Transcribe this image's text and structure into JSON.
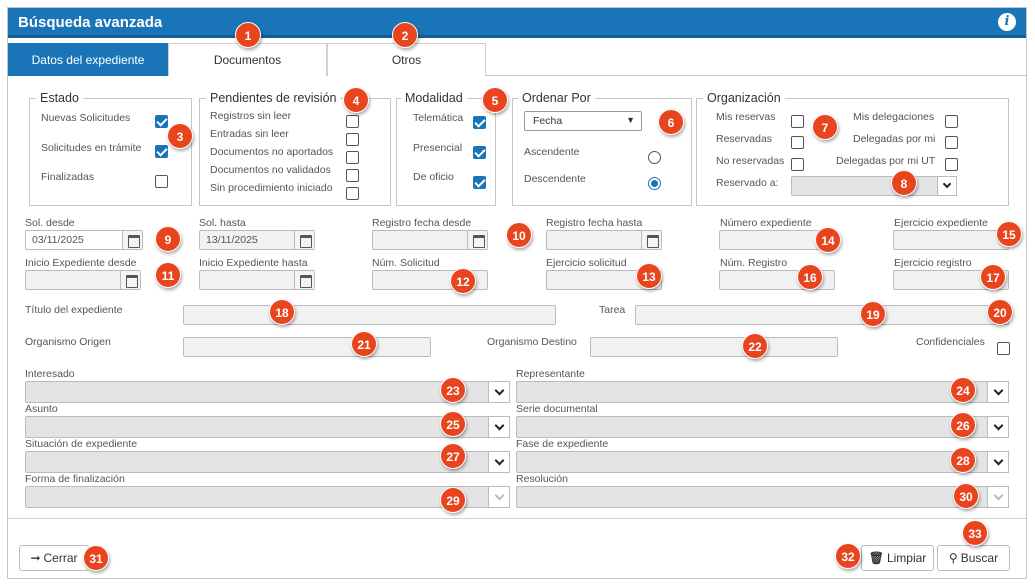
{
  "window": {
    "title": "Búsqueda avanzada",
    "info_icon": "info-icon"
  },
  "tabs": [
    {
      "label": "Datos del expediente",
      "active": true
    },
    {
      "label": "Documentos",
      "active": false
    },
    {
      "label": "Otros",
      "active": false
    }
  ],
  "estado": {
    "legend": "Estado",
    "items": [
      {
        "label": "Nuevas Solicitudes",
        "checked": true
      },
      {
        "label": "Solicitudes en trámite",
        "checked": true
      },
      {
        "label": "Finalizadas",
        "checked": false
      }
    ]
  },
  "pendientes": {
    "legend": "Pendientes de revisión",
    "items": [
      {
        "label": "Registros sin leer",
        "checked": false
      },
      {
        "label": "Entradas sin leer",
        "checked": false
      },
      {
        "label": "Documentos no aportados",
        "checked": false
      },
      {
        "label": "Documentos no validados",
        "checked": false
      },
      {
        "label": "Sin procedimiento iniciado",
        "checked": false
      }
    ]
  },
  "modalidad": {
    "legend": "Modalidad",
    "items": [
      {
        "label": "Telemática",
        "checked": true
      },
      {
        "label": "Presencial",
        "checked": true
      },
      {
        "label": "De oficio",
        "checked": true
      }
    ]
  },
  "ordenar": {
    "legend": "Ordenar Por",
    "select_value": "Fecha",
    "ascendente": "Ascendente",
    "descendente": "Descendente",
    "selected": "Descendente"
  },
  "organizacion": {
    "legend": "Organización",
    "mis_reservas": "Mis reservas",
    "reservadas": "Reservadas",
    "no_reservadas": "No reservadas",
    "mis_delegaciones": "Mis delegaciones",
    "delegadas_por_mi": "Delegadas por mi",
    "delegadas_por_mi_ut": "Delegadas por mi UT",
    "reservado_a": "Reservado a:"
  },
  "fields": {
    "sol_desde": {
      "label": "Sol. desde",
      "value": "03/11/2025"
    },
    "sol_hasta": {
      "label": "Sol. hasta",
      "value": "13/11/2025"
    },
    "registro_fecha_desde": {
      "label": "Registro fecha desde",
      "value": ""
    },
    "registro_fecha_hasta": {
      "label": "Registro fecha hasta",
      "value": ""
    },
    "numero_expediente": {
      "label": "Número expediente",
      "value": ""
    },
    "ejercicio_expediente": {
      "label": "Ejercicio expediente",
      "value": ""
    },
    "inicio_exp_desde": {
      "label": "Inicio Expediente desde",
      "value": ""
    },
    "inicio_exp_hasta": {
      "label": "Inicio Expediente hasta",
      "value": ""
    },
    "num_solicitud": {
      "label": "Núm. Solicitud",
      "value": ""
    },
    "ejercicio_solicitud": {
      "label": "Ejercicio solicitud",
      "value": ""
    },
    "num_registro": {
      "label": "Núm. Registro",
      "value": ""
    },
    "ejercicio_registro": {
      "label": "Ejercicio registro",
      "value": ""
    },
    "titulo": {
      "label": "Título del expediente",
      "value": ""
    },
    "tarea": {
      "label": "Tarea",
      "value": ""
    },
    "organismo_origen": {
      "label": "Organismo Origen",
      "value": ""
    },
    "organismo_destino": {
      "label": "Organismo Destino",
      "value": ""
    },
    "confidenciales": {
      "label": "Confidenciales",
      "checked": false
    }
  },
  "combos": {
    "interesado": "Interesado",
    "representante": "Representante",
    "asunto": "Asunto",
    "serie_documental": "Serie documental",
    "situacion": "Situación de expediente",
    "fase": "Fase de expediente",
    "forma_finalizacion": "Forma de finalización",
    "resolucion": "Resolución"
  },
  "footer": {
    "cerrar": "Cerrar",
    "limpiar": "Limpiar",
    "buscar": "Buscar"
  },
  "badges": [
    "1",
    "2",
    "3",
    "4",
    "5",
    "6",
    "7",
    "8",
    "9",
    "10",
    "11",
    "12",
    "13",
    "14",
    "15",
    "16",
    "17",
    "18",
    "19",
    "20",
    "21",
    "22",
    "23",
    "24",
    "25",
    "26",
    "27",
    "28",
    "29",
    "30",
    "31",
    "32",
    "33"
  ],
  "colors": {
    "primary": "#1a75b8",
    "badge": "#e8451f"
  }
}
